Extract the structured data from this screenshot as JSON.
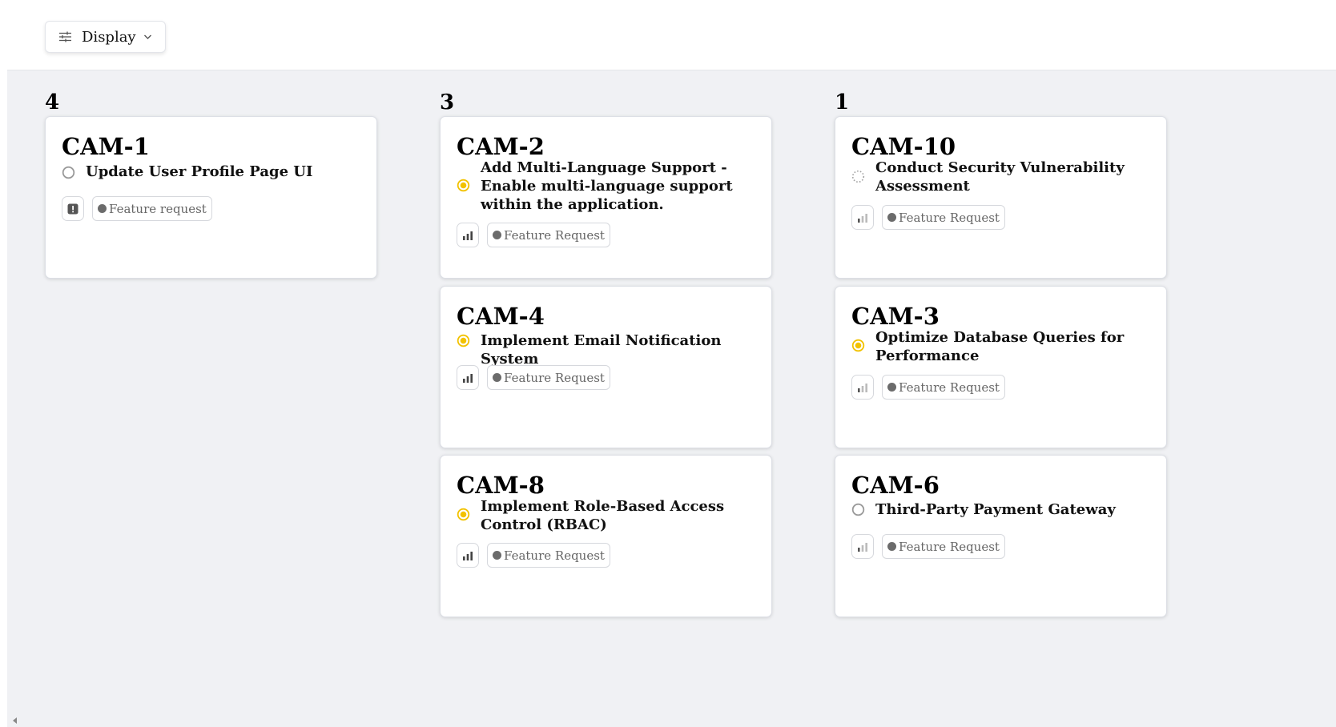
{
  "toolbar": {
    "display_label": "Display",
    "icons": [
      "sliders-icon",
      "chevron-down-icon"
    ]
  },
  "columns": [
    {
      "count": "4",
      "cards": [
        {
          "id": "CAM-1",
          "title": "Update User Profile Page UI",
          "status": "todo",
          "priority": "urgent",
          "label": "Feature request"
        }
      ]
    },
    {
      "count": "3",
      "cards": [
        {
          "id": "CAM-2",
          "title": "Add Multi-Language Support - Enable multi-language support within the application.",
          "status": "in-progress",
          "priority": "high",
          "label": "Feature Request"
        },
        {
          "id": "CAM-4",
          "title": "Implement Email Notification System",
          "status": "in-progress",
          "priority": "high",
          "label": "Feature Request"
        },
        {
          "id": "CAM-8",
          "title": "Implement Role-Based Access Control (RBAC)",
          "status": "in-progress",
          "priority": "high",
          "label": "Feature Request"
        }
      ]
    },
    {
      "count": "1",
      "cards": [
        {
          "id": "CAM-10",
          "title": "Conduct Security Vulnerability Assessment",
          "status": "backlog",
          "priority": "low",
          "label": "Feature Request"
        },
        {
          "id": "CAM-3",
          "title": "Optimize Database Queries for Performance",
          "status": "in-progress",
          "priority": "low",
          "label": "Feature Request"
        },
        {
          "id": "CAM-6",
          "title": "Third-Party Payment Gateway",
          "status": "todo",
          "priority": "low",
          "label": "Feature Request"
        }
      ]
    }
  ],
  "colors": {
    "board_bg": "#f0f1f4",
    "in_progress": "#f2c200",
    "todo": "#9a9a9a",
    "backlog": "#a0a0a0",
    "label_dot": "#6b6b6b"
  }
}
